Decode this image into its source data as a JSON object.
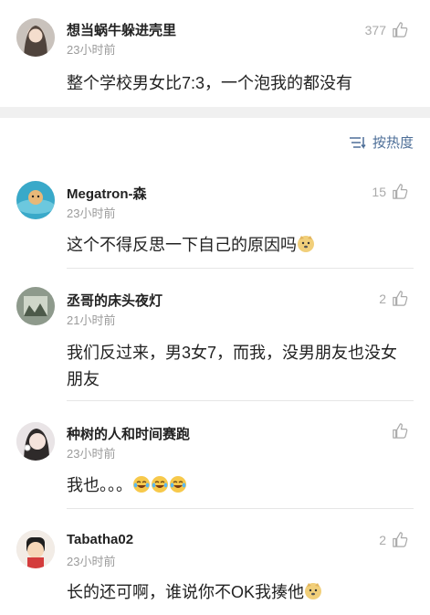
{
  "top_comment": {
    "name": "想当蜗牛躲进壳里",
    "time": "23小时前",
    "likes": "377",
    "text": "整个学校男女比7:3，一个泡我的都没有"
  },
  "sort": {
    "label": "按热度"
  },
  "replies": [
    {
      "name": "Megatron-森",
      "time": "23小时前",
      "likes": "15",
      "text": "这个不得反思一下自己的原因吗",
      "emoji": [
        "doge"
      ]
    },
    {
      "name": "丞哥的床头夜灯",
      "time": "21小时前",
      "likes": "2",
      "text": "我们反过来，男3女7，而我，没男朋友也没女朋友",
      "emoji": []
    },
    {
      "name": "种树的人和时间赛跑",
      "time": "23小时前",
      "likes": "",
      "text": "我也。。。",
      "emoji": [
        "laugh-cry",
        "laugh-cry",
        "laugh-cry"
      ]
    },
    {
      "name": "Tabatha02",
      "time": "23小时前",
      "likes": "2",
      "text": "长的还可啊，谁说你不OK我揍他",
      "emoji": [
        "doge"
      ]
    }
  ],
  "colors": {
    "link": "#4e6f98",
    "meta": "#9b9b9b",
    "band": "#f0f0f0"
  }
}
